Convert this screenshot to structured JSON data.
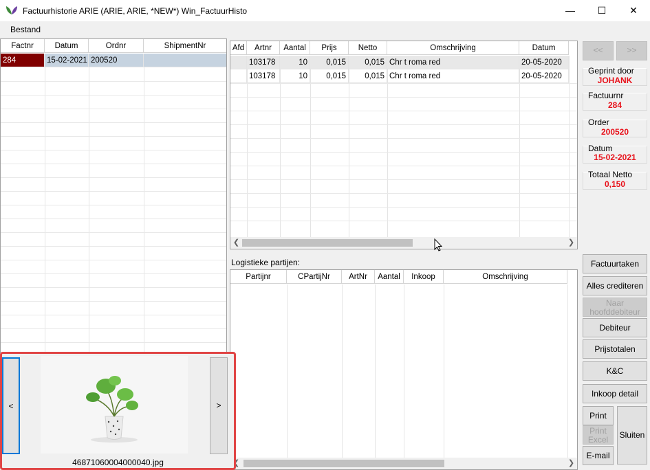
{
  "window": {
    "title": "Factuurhistorie ARIE (ARIE, ARIE, *NEW*) Win_FactuurHisto",
    "minimize": "—",
    "maximize": "☐",
    "close": "✕",
    "icon": "leaf-icon"
  },
  "menu": {
    "bestand": "Bestand"
  },
  "left_grid": {
    "columns": [
      "Factnr",
      "Datum",
      "Ordnr",
      "ShipmentNr"
    ],
    "rows": [
      [
        "284",
        "15-02-2021",
        "200520",
        ""
      ]
    ]
  },
  "lines_grid": {
    "columns": [
      "Afd",
      "Artnr",
      "Aantal",
      "Prijs",
      "Netto",
      "Omschrijving",
      "Datum"
    ],
    "rows": [
      [
        "",
        "103178",
        "10",
        "0,015",
        "0,015",
        "Chr t roma red",
        "20-05-2020"
      ],
      [
        "",
        "103178",
        "10",
        "0,015",
        "0,015",
        "Chr t roma red",
        "20-05-2020"
      ]
    ]
  },
  "logistics": {
    "label": "Logistieke partijen:",
    "columns": [
      "Partijnr",
      "CPartijNr",
      "ArtNr",
      "Aantal",
      "Inkoop",
      "Omschrijving"
    ]
  },
  "nav": {
    "prev": "<<",
    "next": ">>"
  },
  "info": {
    "geprint_door_label": "Geprint door",
    "geprint_door_value": "JOHANK",
    "factuurnr_label": "Factuurnr",
    "factuurnr_value": "284",
    "order_label": "Order",
    "order_value": "200520",
    "datum_label": "Datum",
    "datum_value": "15-02-2021",
    "totaal_netto_label": "Totaal Netto",
    "totaal_netto_value": "0,150"
  },
  "buttons": {
    "factuurtaken": "Factuurtaken",
    "alles_crediteren": "Alles crediteren",
    "naar_hoofddebiteur": "Naar hoofddebiteur",
    "debiteur": "Debiteur",
    "prijstotalen": "Prijstotalen",
    "kc": "K&C",
    "inkoop_detail": "Inkoop detail",
    "print": "Print",
    "print_excel": "Print Excel",
    "email": "E-mail",
    "sluiten": "Sluiten"
  },
  "gallery": {
    "prev": "<",
    "next": ">",
    "filename": "46871060004000040.jpg"
  },
  "colors": {
    "selected_row": "#800000",
    "row_highlight": "#c6d3e0",
    "info_red": "#e8111a"
  }
}
